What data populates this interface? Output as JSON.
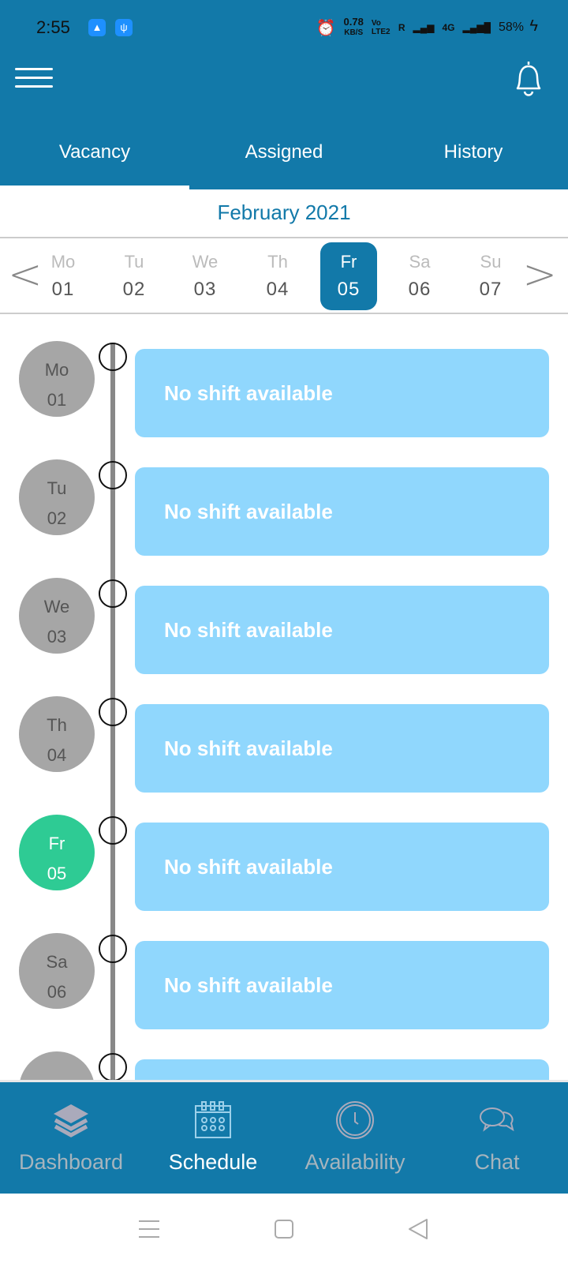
{
  "status_bar": {
    "time": "2:55",
    "speed": "0.78",
    "speed_unit": "KB/S",
    "volte": "Vo LTE2",
    "roaming": "R",
    "network": "4G",
    "battery": "58%",
    "icons": [
      "android-icon",
      "usb-icon",
      "alarm-icon",
      "signal-icon",
      "charging-icon"
    ]
  },
  "header": {
    "icons": [
      "menu-icon",
      "bell-icon"
    ]
  },
  "tabs": [
    {
      "label": "Vacancy",
      "active": true
    },
    {
      "label": "Assigned"
    },
    {
      "label": "History"
    }
  ],
  "month": "February 2021",
  "week": [
    {
      "wd": "Mo",
      "dn": "01"
    },
    {
      "wd": "Tu",
      "dn": "02"
    },
    {
      "wd": "We",
      "dn": "03"
    },
    {
      "wd": "Th",
      "dn": "04"
    },
    {
      "wd": "Fr",
      "dn": "05",
      "selected": true
    },
    {
      "wd": "Sa",
      "dn": "06"
    },
    {
      "wd": "Su",
      "dn": "07"
    }
  ],
  "timeline": [
    {
      "wd": "Mo",
      "dn": "01",
      "text": "No shift available"
    },
    {
      "wd": "Tu",
      "dn": "02",
      "text": "No shift available"
    },
    {
      "wd": "We",
      "dn": "03",
      "text": "No shift available"
    },
    {
      "wd": "Th",
      "dn": "04",
      "text": "No shift available"
    },
    {
      "wd": "Fr",
      "dn": "05",
      "text": "No shift available",
      "today": true
    },
    {
      "wd": "Sa",
      "dn": "06",
      "text": "No shift available"
    },
    {
      "wd": "",
      "dn": "",
      "text": ""
    }
  ],
  "bottom_nav": [
    {
      "label": "Dashboard",
      "icon": "layers-icon"
    },
    {
      "label": "Schedule",
      "icon": "calendar-icon",
      "active": true
    },
    {
      "label": "Availability",
      "icon": "clock-icon"
    },
    {
      "label": "Chat",
      "icon": "chat-icon"
    }
  ],
  "colors": {
    "primary": "#1279a9",
    "card": "#90d7fd",
    "today": "#2ecb94",
    "day_circle": "#a6a6a6"
  }
}
